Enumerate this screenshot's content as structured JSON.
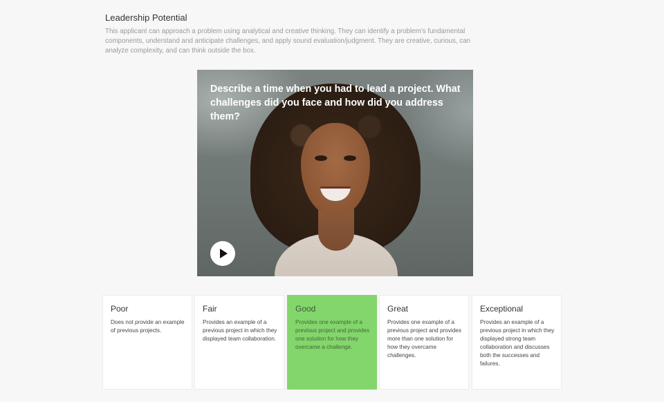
{
  "section": {
    "title": "Leadership Potential",
    "description": "This applicant can approach a problem using analytical and creative thinking. They can identify a problem’s fundamental components, understand and anticipate challenges, and apply sound evaluation/judgment. They are creative, curious, can analyze complexity, and can think outside the box."
  },
  "video": {
    "question": "Describe a time when you had to lead a project.  What challenges did you face and how did you address them?",
    "play_icon": "play-icon"
  },
  "ratings": [
    {
      "label": "Poor",
      "description": "Does not provide an example of previous projects."
    },
    {
      "label": "Fair",
      "description": "Provides an example of a previous project in which they displayed team collaboration."
    },
    {
      "label": "Good",
      "description": "Provides one example of a previous project and provides one solution for how they overcame a challenge.",
      "selected": true
    },
    {
      "label": "Great",
      "description": "Provides one example of a previous project and provides more than one solution for how they overcame challenges."
    },
    {
      "label": "Exceptional",
      "description": "Provides an example of a previous project in which they displayed strong team collaboration and discusses both the successes and failures."
    }
  ],
  "colors": {
    "selected": "#82d66b"
  }
}
